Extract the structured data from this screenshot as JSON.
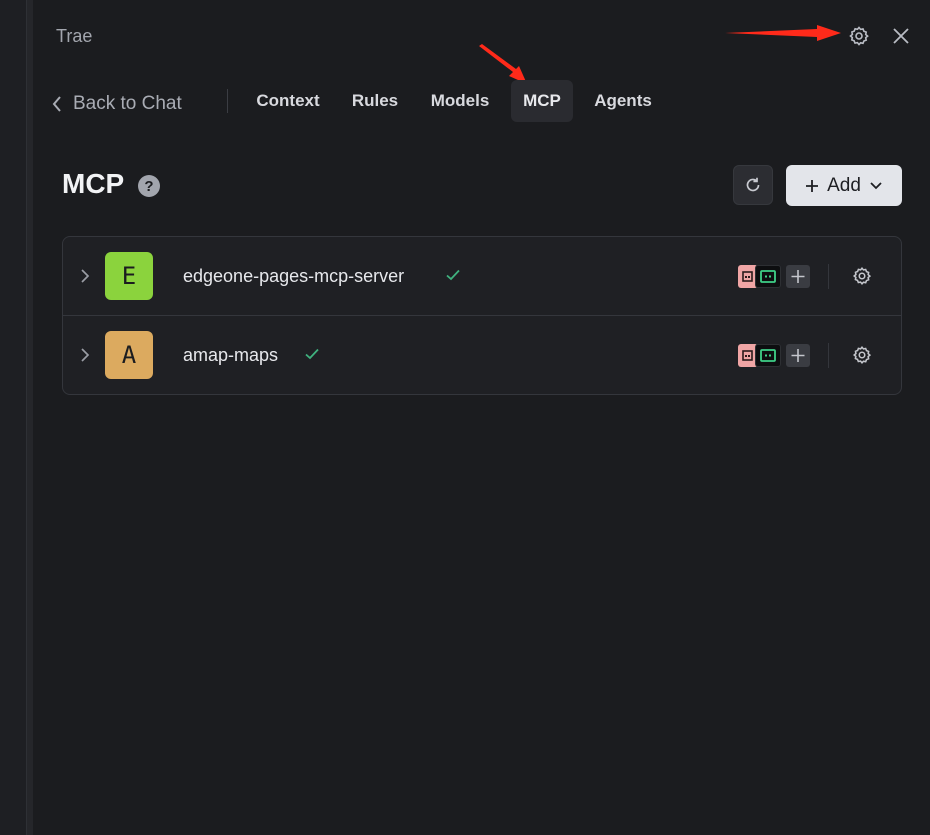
{
  "app": {
    "title": "Trae"
  },
  "nav": {
    "back_label": "Back to Chat",
    "tabs": [
      {
        "label": "Context",
        "active": false
      },
      {
        "label": "Rules",
        "active": false
      },
      {
        "label": "Models",
        "active": false
      },
      {
        "label": "MCP",
        "active": true
      },
      {
        "label": "Agents",
        "active": false
      }
    ]
  },
  "section": {
    "title": "MCP",
    "help_glyph": "?",
    "add_label": "Add"
  },
  "servers": [
    {
      "initial": "E",
      "name": "edgeone-pages-mcp-server",
      "status": "connected",
      "avatar_color": "#8bd33d"
    },
    {
      "initial": "A",
      "name": "amap-maps",
      "status": "connected",
      "avatar_color": "#dcaa5f"
    }
  ],
  "colors": {
    "background": "#1b1c1f",
    "accent_check": "#3fb27f",
    "annotation_arrow": "#ff2a1a"
  },
  "icons": [
    "gear-icon",
    "close-icon",
    "chevron-left-icon",
    "help-icon",
    "refresh-icon",
    "plus-icon",
    "chevron-down-icon",
    "chevron-right-icon",
    "check-icon"
  ]
}
